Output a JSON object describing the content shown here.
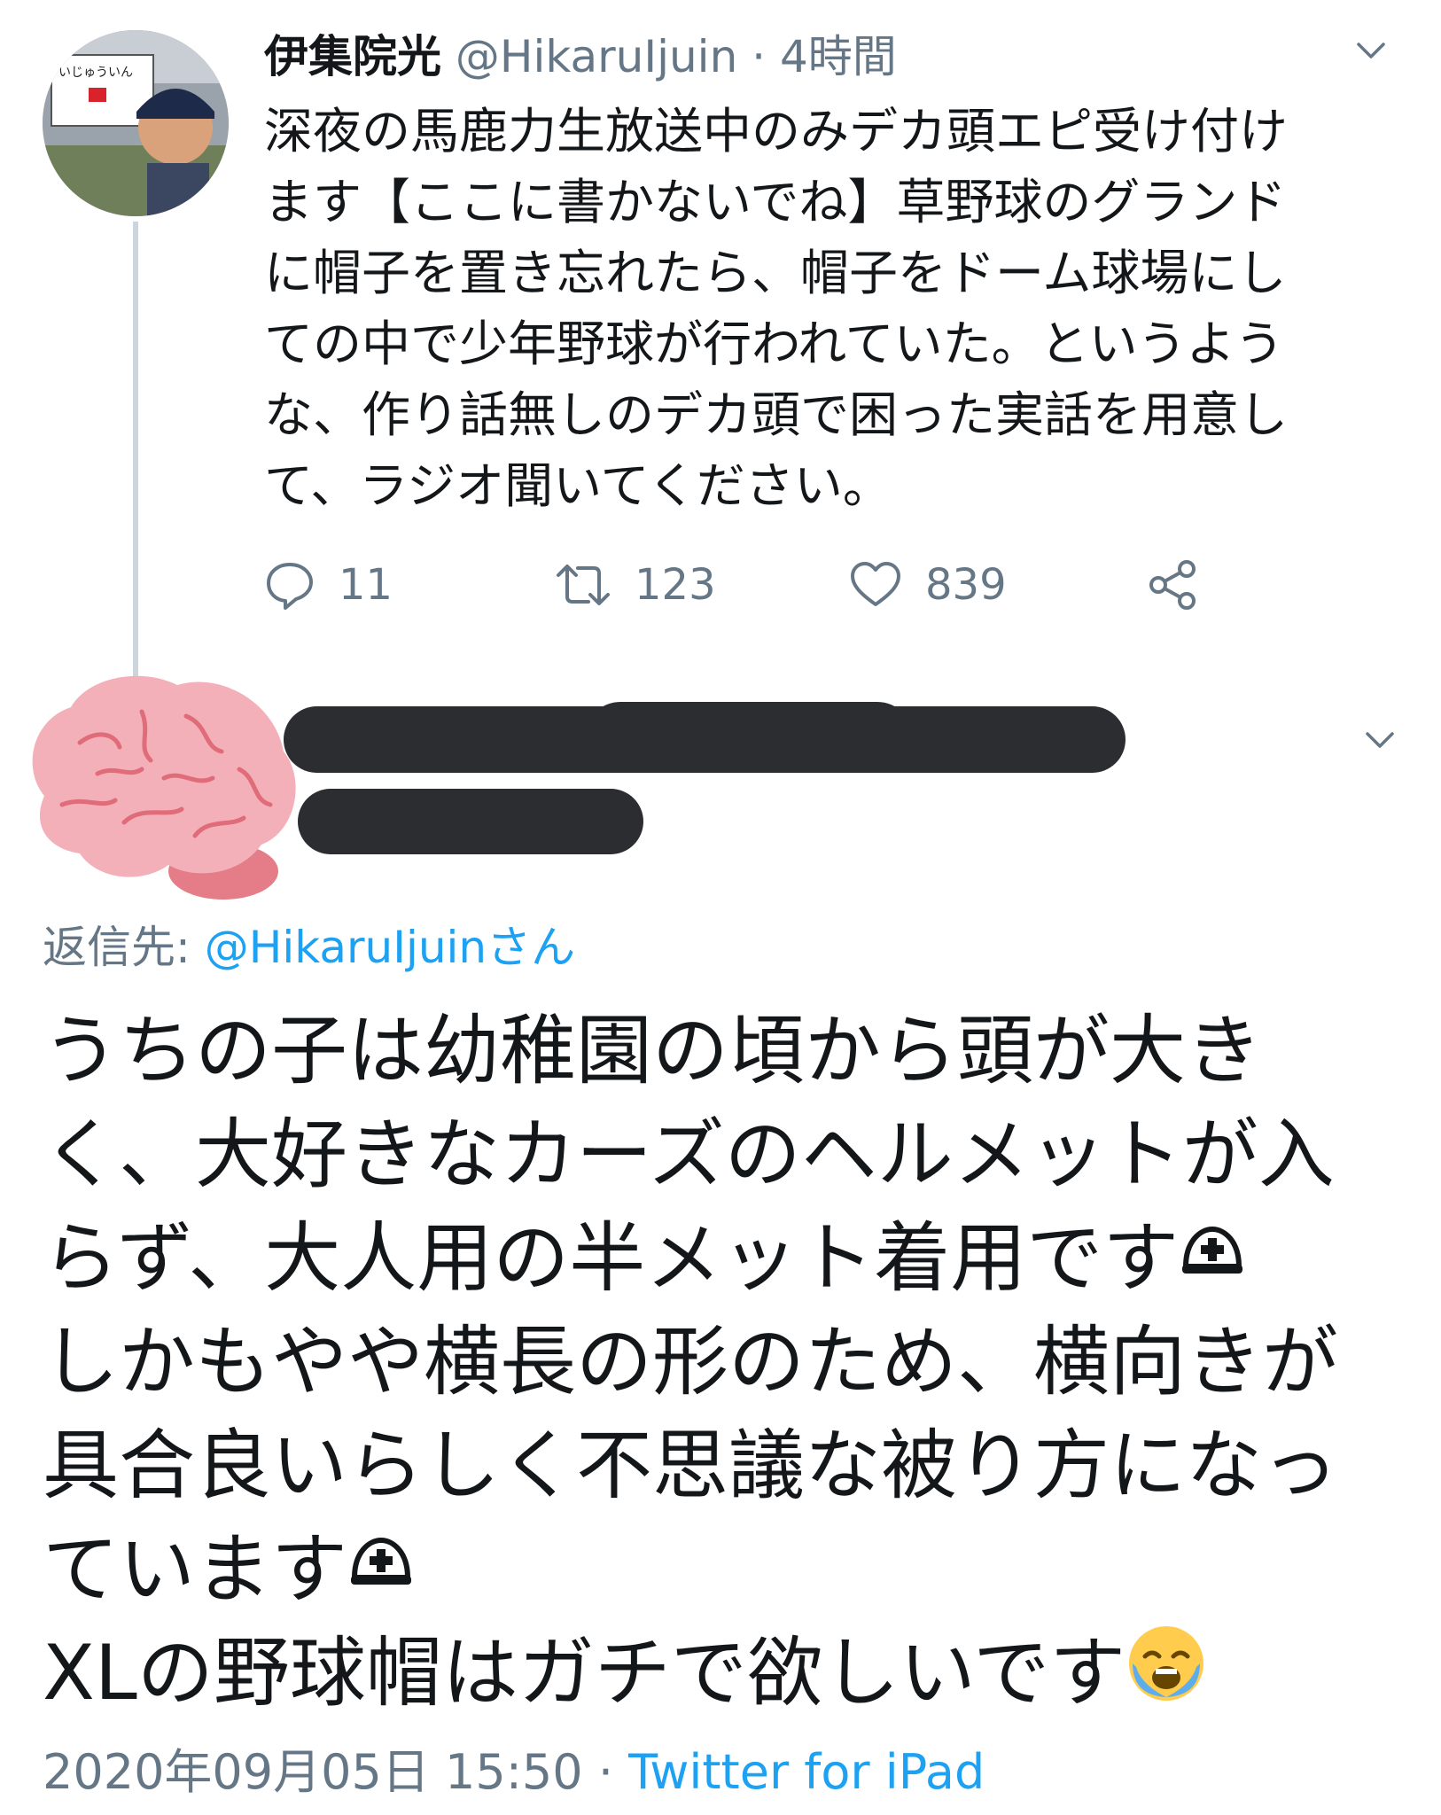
{
  "parent_tweet": {
    "name": "伊集院光",
    "handle": "@HikaruIjuin",
    "separator": "·",
    "time": "4時間",
    "text": "深夜の馬鹿力生放送中のみデカ頭エピ受け付け\nます【ここに書かないでね】草野球のグランド\nに帽子を置き忘れたら、帽子をドーム球場にし\nての中で少年野球が行われていた。というよう\nな、作り話無しのデカ頭で困った実話を用意し\nて、ラジオ聞いてください。",
    "actions": {
      "replies": "11",
      "retweets": "123",
      "likes": "839"
    },
    "avatar_sign_text": "いじゅういん"
  },
  "reply": {
    "reply_to_label": "返信先:",
    "reply_to_handle": "@HikaruIjuinさん",
    "lines": [
      "うちの子は幼稚園の頃から頭が大き",
      "く、大好きなカーズのヘルメットが入",
      "らず、大人用の半メット着用です",
      "しかもやや横長の形のため、横向きが",
      "具合良いらしく不思議な被り方になっ",
      "ています",
      "XLの野球帽はガチで欲しいです"
    ],
    "date": "2020年09月05日 15:50",
    "separator": "·",
    "source": "Twitter for iPad"
  },
  "colors": {
    "text": "#14171a",
    "secondary": "#657786",
    "link": "#1da1f2",
    "redaction": "#2b2d31",
    "thread_line": "#cdd5dc",
    "brain": "#f4b0b8"
  },
  "icons": [
    "reply-icon",
    "retweet-icon",
    "like-icon",
    "share-icon",
    "chevron-down-icon",
    "brain-emoji",
    "helmet-emoji",
    "crying-face-emoji"
  ]
}
